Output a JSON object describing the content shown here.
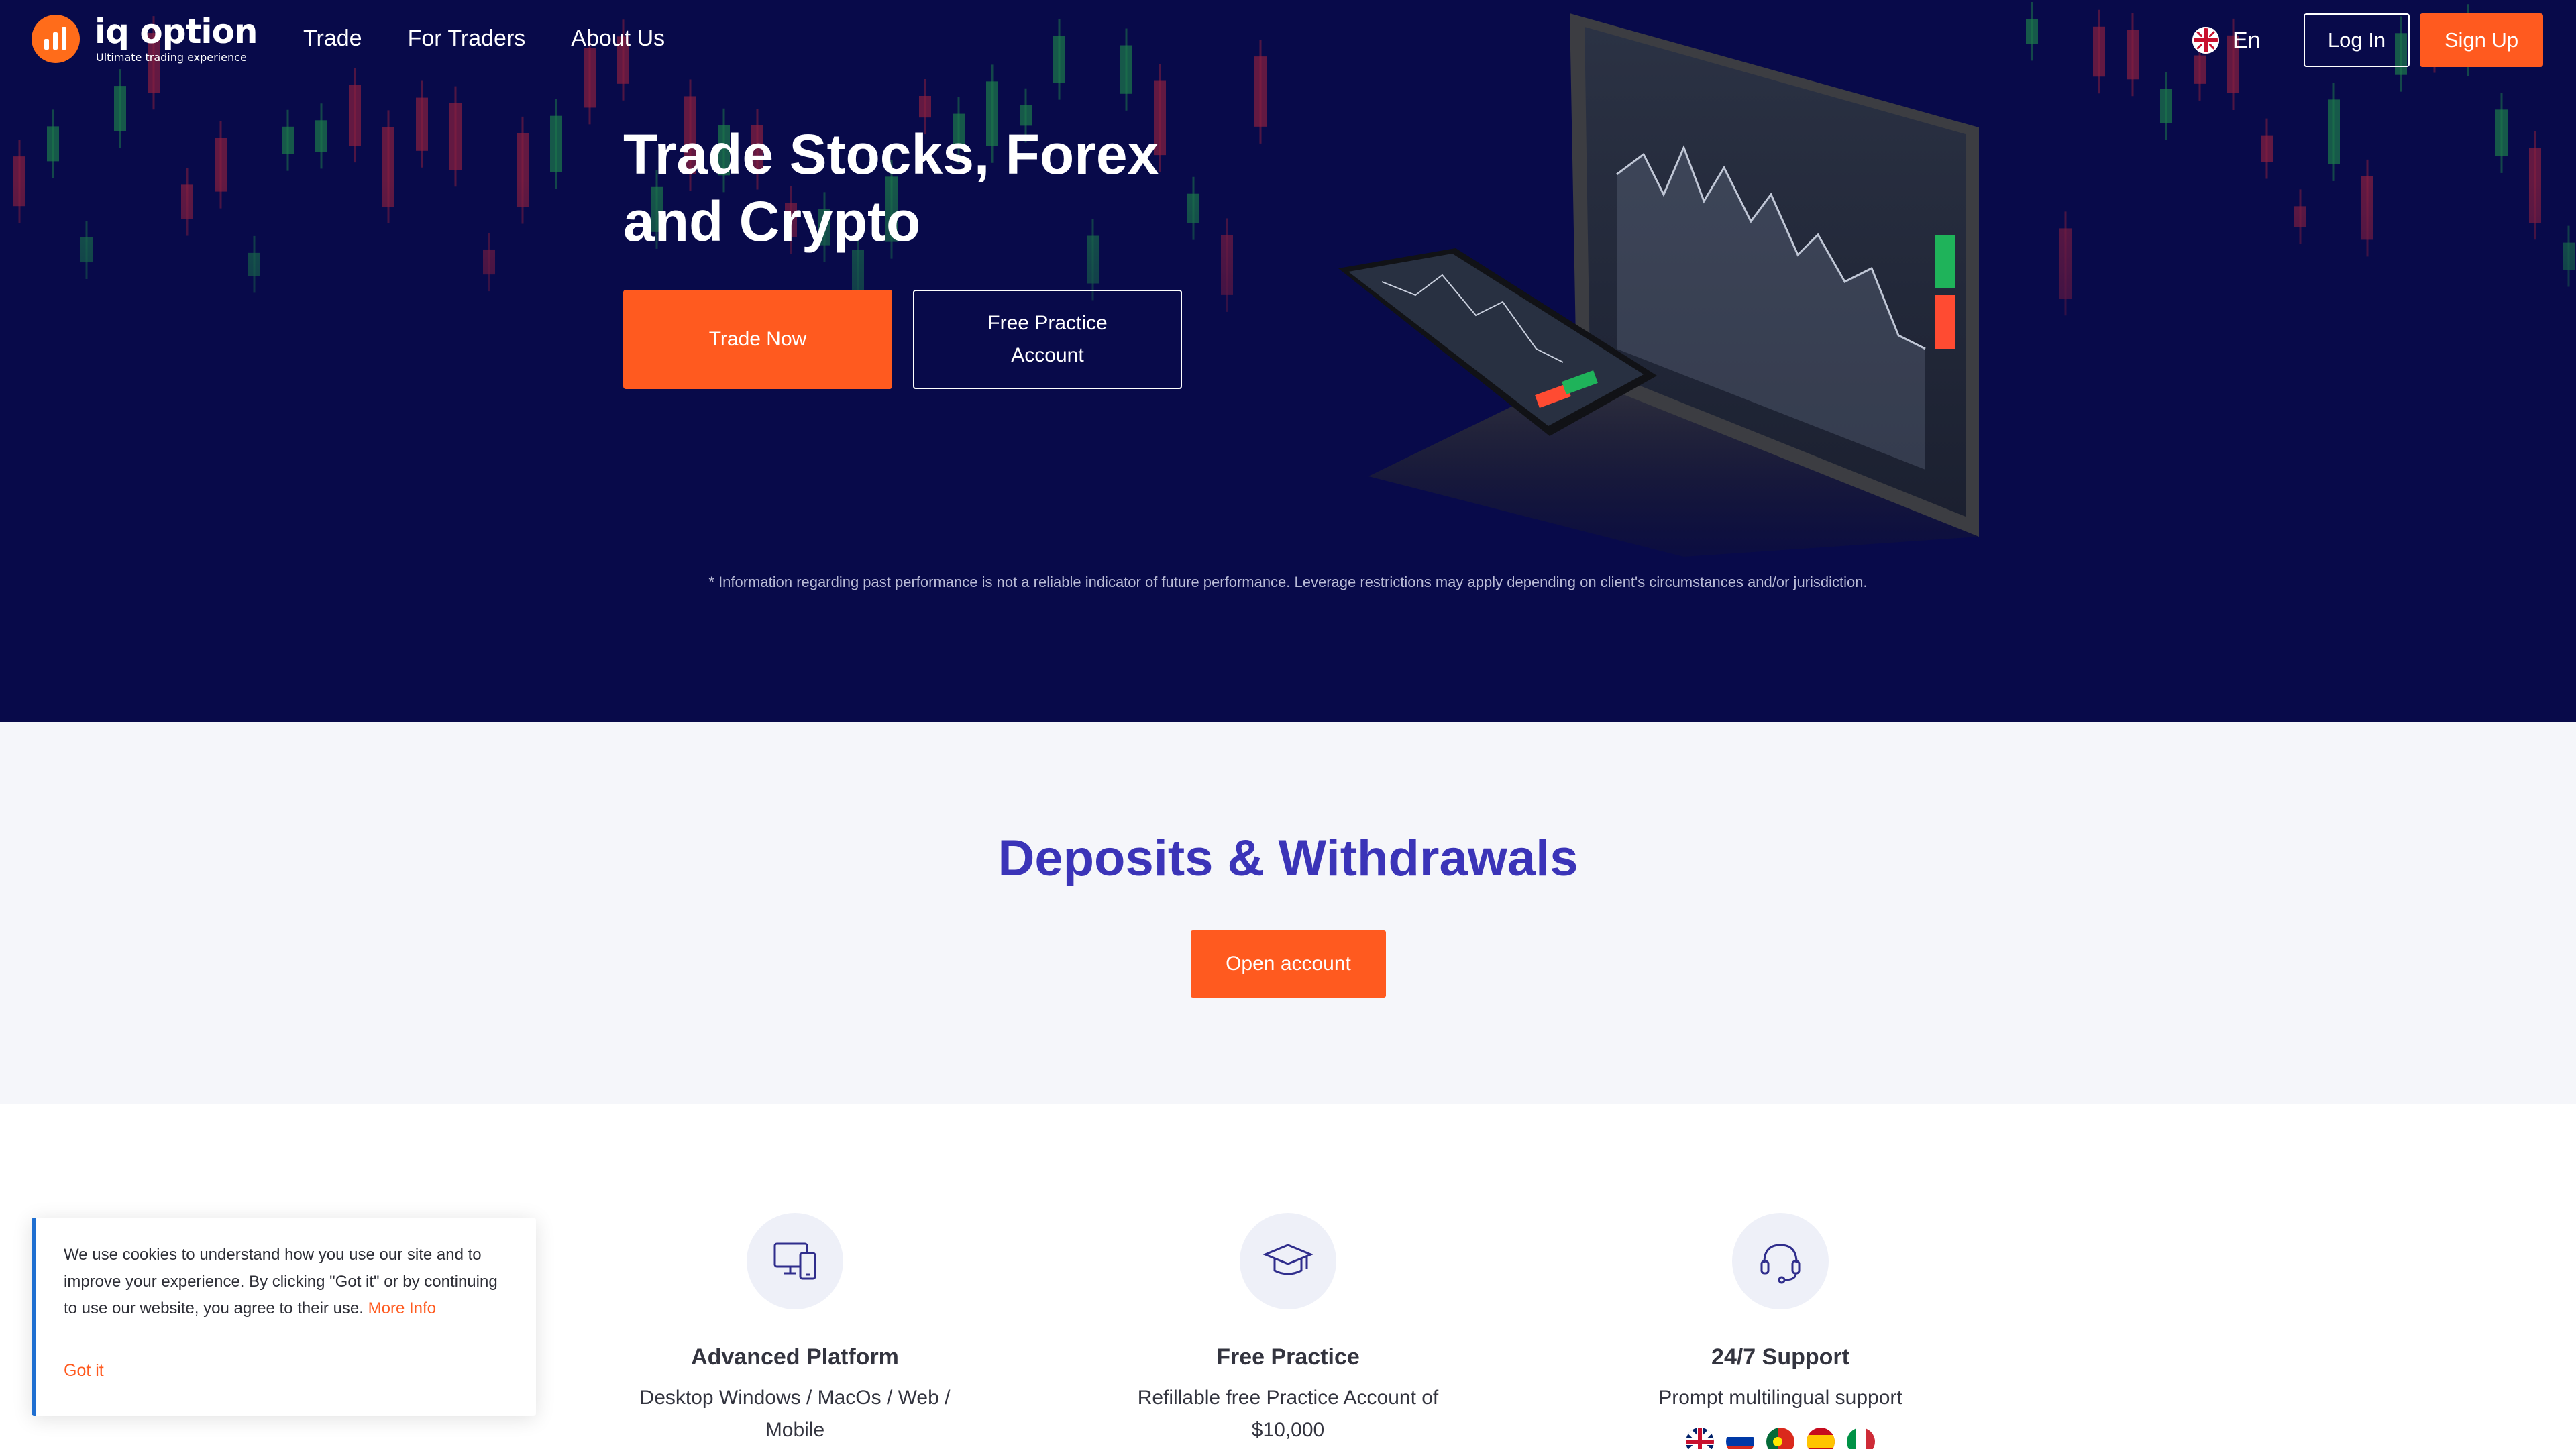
{
  "brand": {
    "name": "iq option",
    "tagline": "Ultimate trading experience",
    "icon": "logo-bars-icon",
    "accent_color": "#ff5a1f",
    "hero_background": "#080a4a",
    "title_color": "#3b34b8"
  },
  "nav": {
    "items": [
      {
        "label": "Trade"
      },
      {
        "label": "For Traders"
      },
      {
        "label": "About Us"
      }
    ]
  },
  "header": {
    "language": {
      "label": "En",
      "icon": "uk-flag-icon"
    },
    "login_label": "Log In",
    "signup_label": "Sign Up"
  },
  "hero": {
    "title": "Trade Stocks, Forex and Crypto",
    "trade_now_label": "Trade Now",
    "practice_label": "Free Practice Account",
    "disclaimer": "* Information regarding past performance is not a reliable indicator of future performance. Leverage restrictions may apply depending on client's circumstances and/or jurisdiction."
  },
  "deposits": {
    "title": "Deposits & Withdrawals",
    "open_account_label": "Open account"
  },
  "features": [
    {
      "title": "Advanced Platform",
      "description": "Desktop Windows / MacOs / Web / Mobile",
      "icon": "devices-icon"
    },
    {
      "title": "Free Practice",
      "description": "Refillable free Practice Account of $10,000",
      "icon": "graduation-cap-icon"
    },
    {
      "title": "24/7 Support",
      "description": "Prompt multilingual support",
      "icon": "headset-icon"
    }
  ],
  "support_flags": [
    "uk-flag-icon",
    "russia-flag-icon",
    "portugal-flag-icon",
    "spain-flag-icon",
    "italy-flag-icon"
  ],
  "cookie": {
    "text": "We use cookies to understand how you use our site and to improve your experience. By clicking \"Got it\" or by continuing to use our website, you agree to their use.",
    "more_info_label": "More Info",
    "got_it_label": "Got it"
  }
}
